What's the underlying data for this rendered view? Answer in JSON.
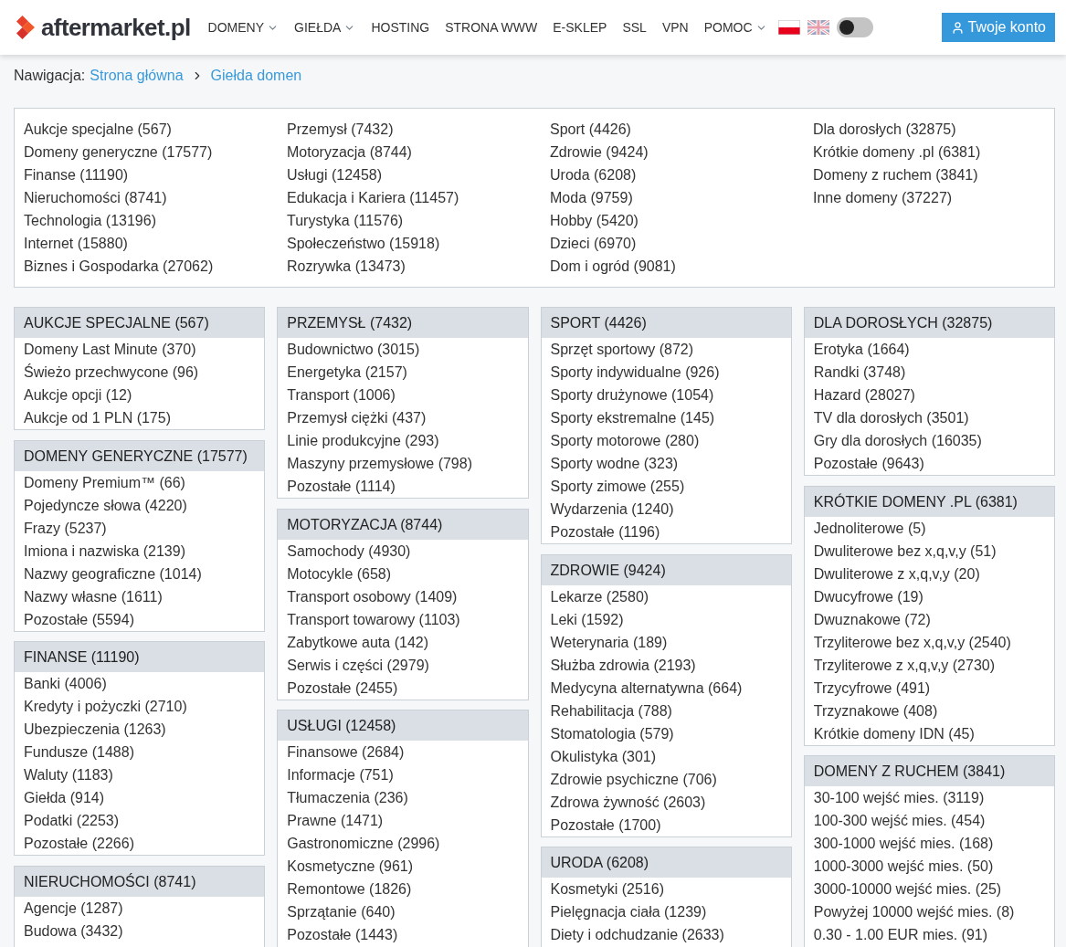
{
  "header": {
    "logo": "aftermarket.pl",
    "nav": [
      {
        "label": "DOMENY",
        "dropdown": true
      },
      {
        "label": "GIEŁDA",
        "dropdown": true
      },
      {
        "label": "HOSTING",
        "dropdown": false
      },
      {
        "label": "STRONA WWW",
        "dropdown": false
      },
      {
        "label": "E-SKLEP",
        "dropdown": false
      },
      {
        "label": "SSL",
        "dropdown": false
      },
      {
        "label": "VPN",
        "dropdown": false
      },
      {
        "label": "POMOC",
        "dropdown": true
      }
    ],
    "languages": [
      {
        "kind": "pl",
        "selected": true
      },
      {
        "kind": "gb",
        "selected": false
      }
    ],
    "dark_mode_toggle": {
      "on": false
    },
    "account_button": "Twoje konto"
  },
  "breadcrumb": {
    "label": "Nawigacja:",
    "links": [
      "Strona główna",
      "Giełda domen"
    ]
  },
  "overview": {
    "columns": [
      [
        "Aukcje specjalne (567)",
        "Domeny generyczne (17577)",
        "Finanse (11190)",
        "Nieruchomości (8741)",
        "Technologia (13196)",
        "Internet (15880)",
        "Biznes i Gospodarka (27062)"
      ],
      [
        "Przemysł (7432)",
        "Motoryzacja (8744)",
        "Usługi (12458)",
        "Edukacja i Kariera (11457)",
        "Turystyka (11576)",
        "Społeczeństwo (15918)",
        "Rozrywka (13473)"
      ],
      [
        "Sport (4426)",
        "Zdrowie (9424)",
        "Uroda (6208)",
        "Moda (9759)",
        "Hobby (5420)",
        "Dzieci (6970)",
        "Dom i ogród (9081)"
      ],
      [
        "Dla dorosłych (32875)",
        "Krótkie domeny .pl (6381)",
        "Domeny z ruchem (3841)",
        "Inne domeny (37227)"
      ]
    ]
  },
  "category_columns": [
    [
      {
        "title": "AUKCJE SPECJALNE (567)",
        "items": [
          "Domeny Last Minute (370)",
          "Świeżo przechwycone (96)",
          "Aukcje opcji (12)",
          "Aukcje od 1 PLN (175)"
        ]
      },
      {
        "title": "DOMENY GENERYCZNE (17577)",
        "items": [
          "Domeny Premium™ (66)",
          "Pojedyncze słowa (4220)",
          "Frazy (5237)",
          "Imiona i nazwiska (2139)",
          "Nazwy geograficzne (1014)",
          "Nazwy własne (1611)",
          "Pozostałe (5594)"
        ]
      },
      {
        "title": "FINANSE (11190)",
        "items": [
          "Banki (4006)",
          "Kredyty i pożyczki (2710)",
          "Ubezpieczenia (1263)",
          "Fundusze (1488)",
          "Waluty (1183)",
          "Giełda (914)",
          "Podatki (2253)",
          "Pozostałe (2266)"
        ]
      },
      {
        "title": "NIERUCHOMOŚCI (8741)",
        "items": [
          "Agencje (1287)",
          "Budowa (3432)"
        ]
      }
    ],
    [
      {
        "title": "PRZEMYSŁ (7432)",
        "items": [
          "Budownictwo (3015)",
          "Energetyka (2157)",
          "Transport (1006)",
          "Przemysł ciężki (437)",
          "Linie produkcyjne (293)",
          "Maszyny przemysłowe (798)",
          "Pozostałe (1114)"
        ]
      },
      {
        "title": "MOTORYZACJA (8744)",
        "items": [
          "Samochody (4930)",
          "Motocykle (658)",
          "Transport osobowy (1409)",
          "Transport towarowy (1103)",
          "Zabytkowe auta (142)",
          "Serwis i części (2979)",
          "Pozostałe (2455)"
        ]
      },
      {
        "title": "USŁUGI (12458)",
        "items": [
          "Finansowe (2684)",
          "Informacje (751)",
          "Tłumaczenia (236)",
          "Prawne (1471)",
          "Gastronomiczne (2996)",
          "Kosmetyczne (961)",
          "Remontowe (1826)",
          "Sprzątanie (640)",
          "Pozostałe (1443)"
        ]
      }
    ],
    [
      {
        "title": "SPORT (4426)",
        "items": [
          "Sprzęt sportowy (872)",
          "Sporty indywidualne (926)",
          "Sporty drużynowe (1054)",
          "Sporty ekstremalne (145)",
          "Sporty motorowe (280)",
          "Sporty wodne (323)",
          "Sporty zimowe (255)",
          "Wydarzenia (1240)",
          "Pozostałe (1196)"
        ]
      },
      {
        "title": "ZDROWIE (9424)",
        "items": [
          "Lekarze (2580)",
          "Leki (1592)",
          "Weterynaria (189)",
          "Służba zdrowia (2193)",
          "Medycyna alternatywna (664)",
          "Rehabilitacja (788)",
          "Stomatologia (579)",
          "Okulistyka (301)",
          "Zdrowie psychiczne (706)",
          "Zdrowa żywność (2603)",
          "Pozostałe (1700)"
        ]
      },
      {
        "title": "URODA (6208)",
        "items": [
          "Kosmetyki (2516)",
          "Pielęgnacja ciała (1239)",
          "Diety i odchudzanie (2633)"
        ]
      }
    ],
    [
      {
        "title": "DLA DOROSŁYCH (32875)",
        "items": [
          "Erotyka (1664)",
          "Randki (3748)",
          "Hazard (28027)",
          "TV dla dorosłych (3501)",
          "Gry dla dorosłych (16035)",
          "Pozostałe (9643)"
        ]
      },
      {
        "title": "KRÓTKIE DOMENY .PL (6381)",
        "items": [
          "Jednoliterowe (5)",
          "Dwuliterowe bez x,q,v,y (51)",
          "Dwuliterowe z x,q,v,y (20)",
          "Dwucyfrowe (19)",
          "Dwuznakowe (72)",
          "Trzyliterowe bez x,q,v,y (2540)",
          "Trzyliterowe z x,q,v,y (2730)",
          "Trzycyfrowe (491)",
          "Trzyznakowe (408)",
          "Krótkie domeny IDN (45)"
        ]
      },
      {
        "title": "DOMENY Z RUCHEM (3841)",
        "items": [
          "30-100 wejść mies. (3119)",
          "100-300 wejść mies. (454)",
          "300-1000 wejść mies. (168)",
          "1000-3000 wejść mies. (50)",
          "3000-10000 wejść mies. (25)",
          "Powyżej 10000 wejść mies. (8)",
          "0.30 - 1.00 EUR mies. (91)"
        ]
      }
    ]
  ]
}
